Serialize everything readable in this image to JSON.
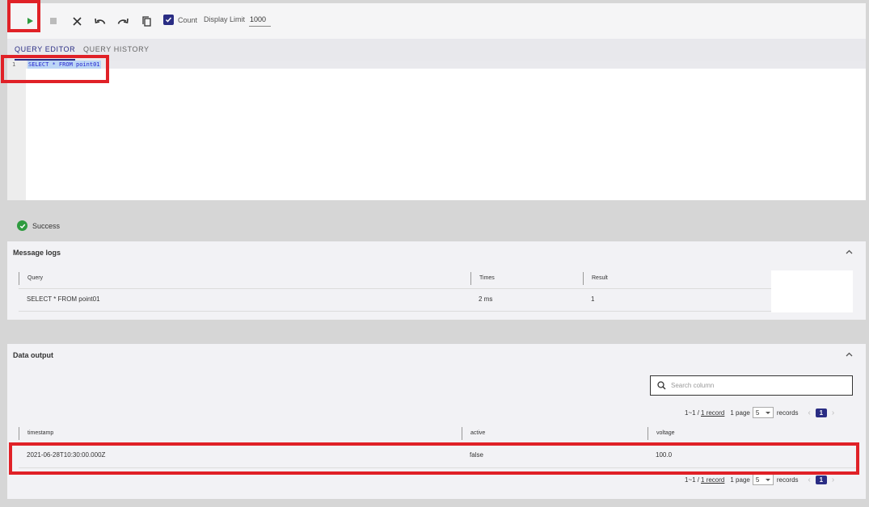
{
  "toolbar": {
    "count_label": "Count",
    "display_limit_label": "Display Limit",
    "display_limit_value": "1000",
    "icons": [
      "play-icon",
      "stop-icon",
      "close-icon",
      "undo-icon",
      "redo-icon",
      "copy-icon",
      "checkbox-checked-icon"
    ]
  },
  "tabs": [
    {
      "label": "QUERY EDITOR",
      "active": true
    },
    {
      "label": "QUERY HISTORY",
      "active": false
    }
  ],
  "editor": {
    "line_number": "1",
    "code": "SELECT * FROM point01"
  },
  "status": {
    "text": "Success",
    "color": "#2e9b3f"
  },
  "message_logs": {
    "title": "Message logs",
    "columns": [
      "Query",
      "Times",
      "Result"
    ],
    "rows": [
      {
        "query": "SELECT * FROM point01",
        "times": "2 ms",
        "result": "1"
      }
    ]
  },
  "data_output": {
    "title": "Data output",
    "search_placeholder": "Search column",
    "pagination": {
      "range": "1~1 /",
      "records_link": "1 record",
      "page_text": "1 page",
      "page_size": "5",
      "records_label": "records",
      "current_page": "1"
    },
    "columns": [
      "timestamp",
      "active",
      "voltage"
    ],
    "rows": [
      {
        "timestamp": "2021-06-28T10:30:00.000Z",
        "active": "false",
        "voltage": "100.0"
      }
    ]
  },
  "colors": {
    "accent": "#2a2d84",
    "highlight": "#e02127",
    "run": "#2e9b3f"
  }
}
